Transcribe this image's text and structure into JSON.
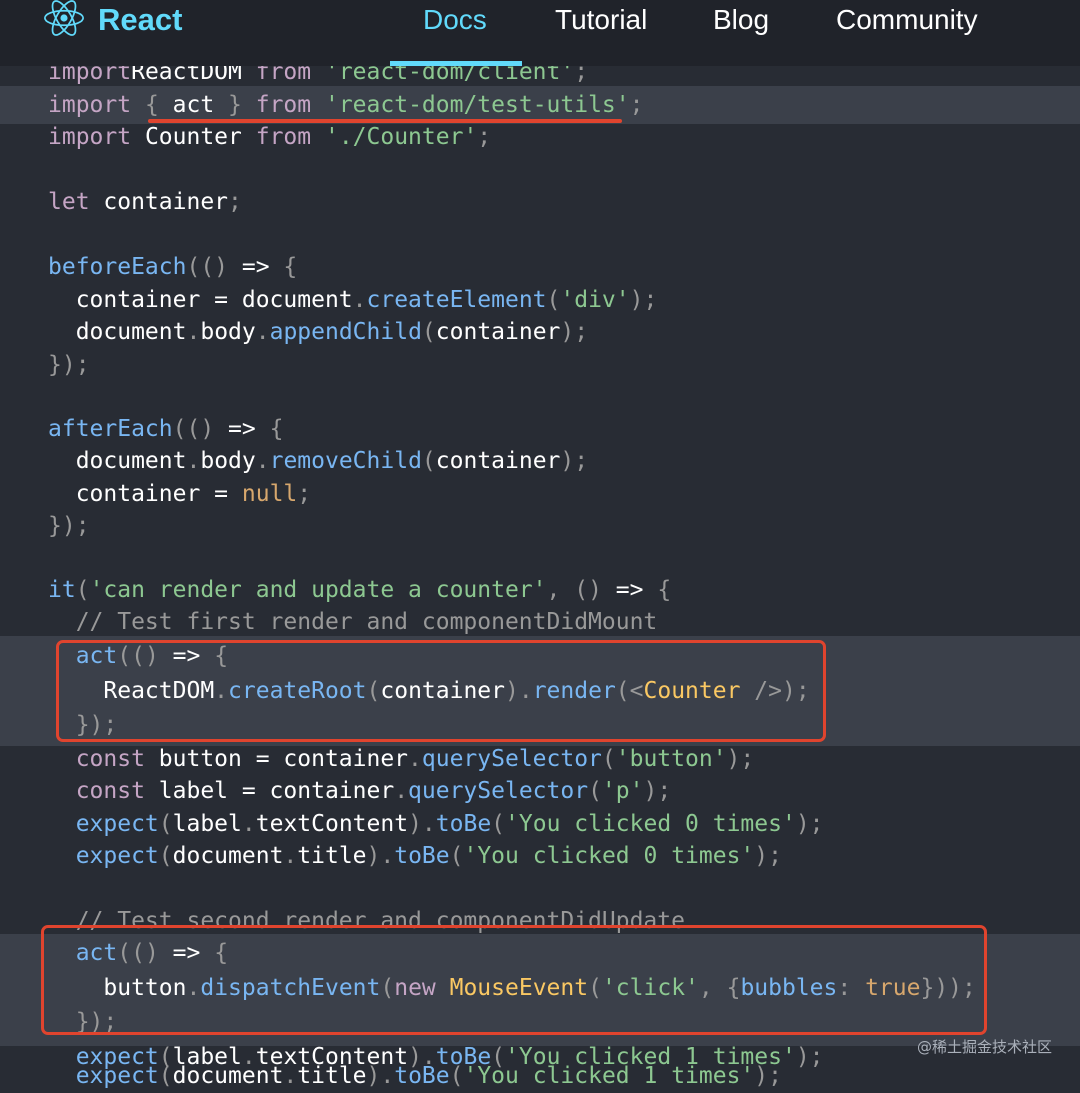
{
  "brand": {
    "name": "React"
  },
  "nav": {
    "items": [
      {
        "label": "Docs",
        "active": true
      },
      {
        "label": "Tutorial",
        "active": false
      },
      {
        "label": "Blog",
        "active": false
      },
      {
        "label": "Community",
        "active": false
      }
    ]
  },
  "code": {
    "lines": [
      [
        [
          "kw",
          "import"
        ],
        [
          "",
          "ReactDOM "
        ],
        [
          "kw",
          "from "
        ],
        [
          "str",
          "'react-dom/client'"
        ],
        [
          "pr",
          ";"
        ]
      ],
      [
        [
          "kw",
          "import "
        ],
        [
          "pr",
          "{ "
        ],
        [
          "",
          "act "
        ],
        [
          "pr",
          "} "
        ],
        [
          "kw",
          "from "
        ],
        [
          "str",
          "'react-dom/test-utils'"
        ],
        [
          "pr",
          ";"
        ]
      ],
      [
        [
          "kw",
          "import "
        ],
        [
          "",
          "Counter "
        ],
        [
          "kw",
          "from "
        ],
        [
          "str",
          "'./Counter'"
        ],
        [
          "pr",
          ";"
        ]
      ],
      [],
      [
        [
          "kw",
          "let "
        ],
        [
          "",
          "container"
        ],
        [
          "pr",
          ";"
        ]
      ],
      [],
      [
        [
          "fn",
          "beforeEach"
        ],
        [
          "pr",
          "(() "
        ],
        [
          "",
          "=> "
        ],
        [
          "pr",
          "{"
        ]
      ],
      [
        [
          "",
          "  container = document"
        ],
        [
          "pr",
          "."
        ],
        [
          "fn",
          "createElement"
        ],
        [
          "pr",
          "("
        ],
        [
          "str",
          "'div'"
        ],
        [
          "pr",
          ");"
        ]
      ],
      [
        [
          "",
          "  document"
        ],
        [
          "pr",
          "."
        ],
        [
          "",
          "body"
        ],
        [
          "pr",
          "."
        ],
        [
          "fn",
          "appendChild"
        ],
        [
          "pr",
          "("
        ],
        [
          "",
          "container"
        ],
        [
          "pr",
          ");"
        ]
      ],
      [
        [
          "pr",
          "});"
        ]
      ],
      [],
      [
        [
          "fn",
          "afterEach"
        ],
        [
          "pr",
          "(() "
        ],
        [
          "",
          "=> "
        ],
        [
          "pr",
          "{"
        ]
      ],
      [
        [
          "",
          "  document"
        ],
        [
          "pr",
          "."
        ],
        [
          "",
          "body"
        ],
        [
          "pr",
          "."
        ],
        [
          "fn",
          "removeChild"
        ],
        [
          "pr",
          "("
        ],
        [
          "",
          "container"
        ],
        [
          "pr",
          ");"
        ]
      ],
      [
        [
          "",
          "  container = "
        ],
        [
          "nul",
          "null"
        ],
        [
          "pr",
          ";"
        ]
      ],
      [
        [
          "pr",
          "});"
        ]
      ],
      [],
      [
        [
          "fn",
          "it"
        ],
        [
          "pr",
          "("
        ],
        [
          "str",
          "'can render and update a counter'"
        ],
        [
          "pr",
          ", () "
        ],
        [
          "",
          "=> "
        ],
        [
          "pr",
          "{"
        ]
      ],
      [
        [
          "cm",
          "  // Test first render and componentDidMount"
        ]
      ],
      [
        [
          "",
          "  "
        ],
        [
          "fn",
          "act"
        ],
        [
          "pr",
          "(() "
        ],
        [
          "",
          "=> "
        ],
        [
          "pr",
          "{"
        ]
      ],
      [
        [
          "",
          "    ReactDOM"
        ],
        [
          "pr",
          "."
        ],
        [
          "fn",
          "createRoot"
        ],
        [
          "pr",
          "("
        ],
        [
          "",
          "container"
        ],
        [
          "pr",
          ")."
        ],
        [
          "fn",
          "render"
        ],
        [
          "pr",
          "(<"
        ],
        [
          "cls",
          "Counter "
        ],
        [
          "pr",
          "/>);"
        ]
      ],
      [
        [
          "pr",
          "  });"
        ]
      ],
      [
        [
          "kw",
          "  const "
        ],
        [
          "",
          "button = container"
        ],
        [
          "pr",
          "."
        ],
        [
          "fn",
          "querySelector"
        ],
        [
          "pr",
          "("
        ],
        [
          "str",
          "'button'"
        ],
        [
          "pr",
          ");"
        ]
      ],
      [
        [
          "kw",
          "  const "
        ],
        [
          "",
          "label = container"
        ],
        [
          "pr",
          "."
        ],
        [
          "fn",
          "querySelector"
        ],
        [
          "pr",
          "("
        ],
        [
          "str",
          "'p'"
        ],
        [
          "pr",
          ");"
        ]
      ],
      [
        [
          "fn",
          "  expect"
        ],
        [
          "pr",
          "("
        ],
        [
          "",
          "label"
        ],
        [
          "pr",
          "."
        ],
        [
          "",
          "textContent"
        ],
        [
          "pr",
          ")."
        ],
        [
          "fn",
          "toBe"
        ],
        [
          "pr",
          "("
        ],
        [
          "str",
          "'You clicked 0 times'"
        ],
        [
          "pr",
          ");"
        ]
      ],
      [
        [
          "fn",
          "  expect"
        ],
        [
          "pr",
          "("
        ],
        [
          "",
          "document"
        ],
        [
          "pr",
          "."
        ],
        [
          "",
          "title"
        ],
        [
          "pr",
          ")."
        ],
        [
          "fn",
          "toBe"
        ],
        [
          "pr",
          "("
        ],
        [
          "str",
          "'You clicked 0 times'"
        ],
        [
          "pr",
          ");"
        ]
      ],
      [],
      [
        [
          "cm",
          "  // Test second render and componentDidUpdate"
        ]
      ],
      [
        [
          "",
          "  "
        ],
        [
          "fn",
          "act"
        ],
        [
          "pr",
          "(() "
        ],
        [
          "",
          "=> "
        ],
        [
          "pr",
          "{"
        ]
      ],
      [
        [
          "",
          "    button"
        ],
        [
          "pr",
          "."
        ],
        [
          "fn",
          "dispatchEvent"
        ],
        [
          "pr",
          "("
        ],
        [
          "kw",
          "new "
        ],
        [
          "cls",
          "MouseEvent"
        ],
        [
          "pr",
          "("
        ],
        [
          "str",
          "'click'"
        ],
        [
          "pr",
          ", {"
        ],
        [
          "fn",
          "bubbles"
        ],
        [
          "pr",
          ": "
        ],
        [
          "nul",
          "true"
        ],
        [
          "pr",
          "}));"
        ]
      ],
      [
        [
          "pr",
          "  });"
        ]
      ],
      [
        [
          "fn",
          "  expect"
        ],
        [
          "pr",
          "("
        ],
        [
          "",
          "label"
        ],
        [
          "pr",
          "."
        ],
        [
          "",
          "textContent"
        ],
        [
          "pr",
          ")."
        ],
        [
          "fn",
          "toBe"
        ],
        [
          "pr",
          "("
        ],
        [
          "str",
          "'You clicked 1 times'"
        ],
        [
          "pr",
          ");"
        ]
      ],
      [
        [
          "fn",
          "  expect"
        ],
        [
          "pr",
          "("
        ],
        [
          "",
          "document"
        ],
        [
          "pr",
          "."
        ],
        [
          "",
          "title"
        ],
        [
          "pr",
          ")."
        ],
        [
          "fn",
          "toBe"
        ],
        [
          "pr",
          "("
        ],
        [
          "str",
          "'You clicked 1 times'"
        ],
        [
          "pr",
          ");"
        ]
      ]
    ]
  },
  "watermark": "@稀土掘金技术社区",
  "colors": {
    "accent": "#61dafb",
    "annotation": "#e0442e",
    "code_background": "#282c34",
    "nav_background": "#20232a"
  }
}
